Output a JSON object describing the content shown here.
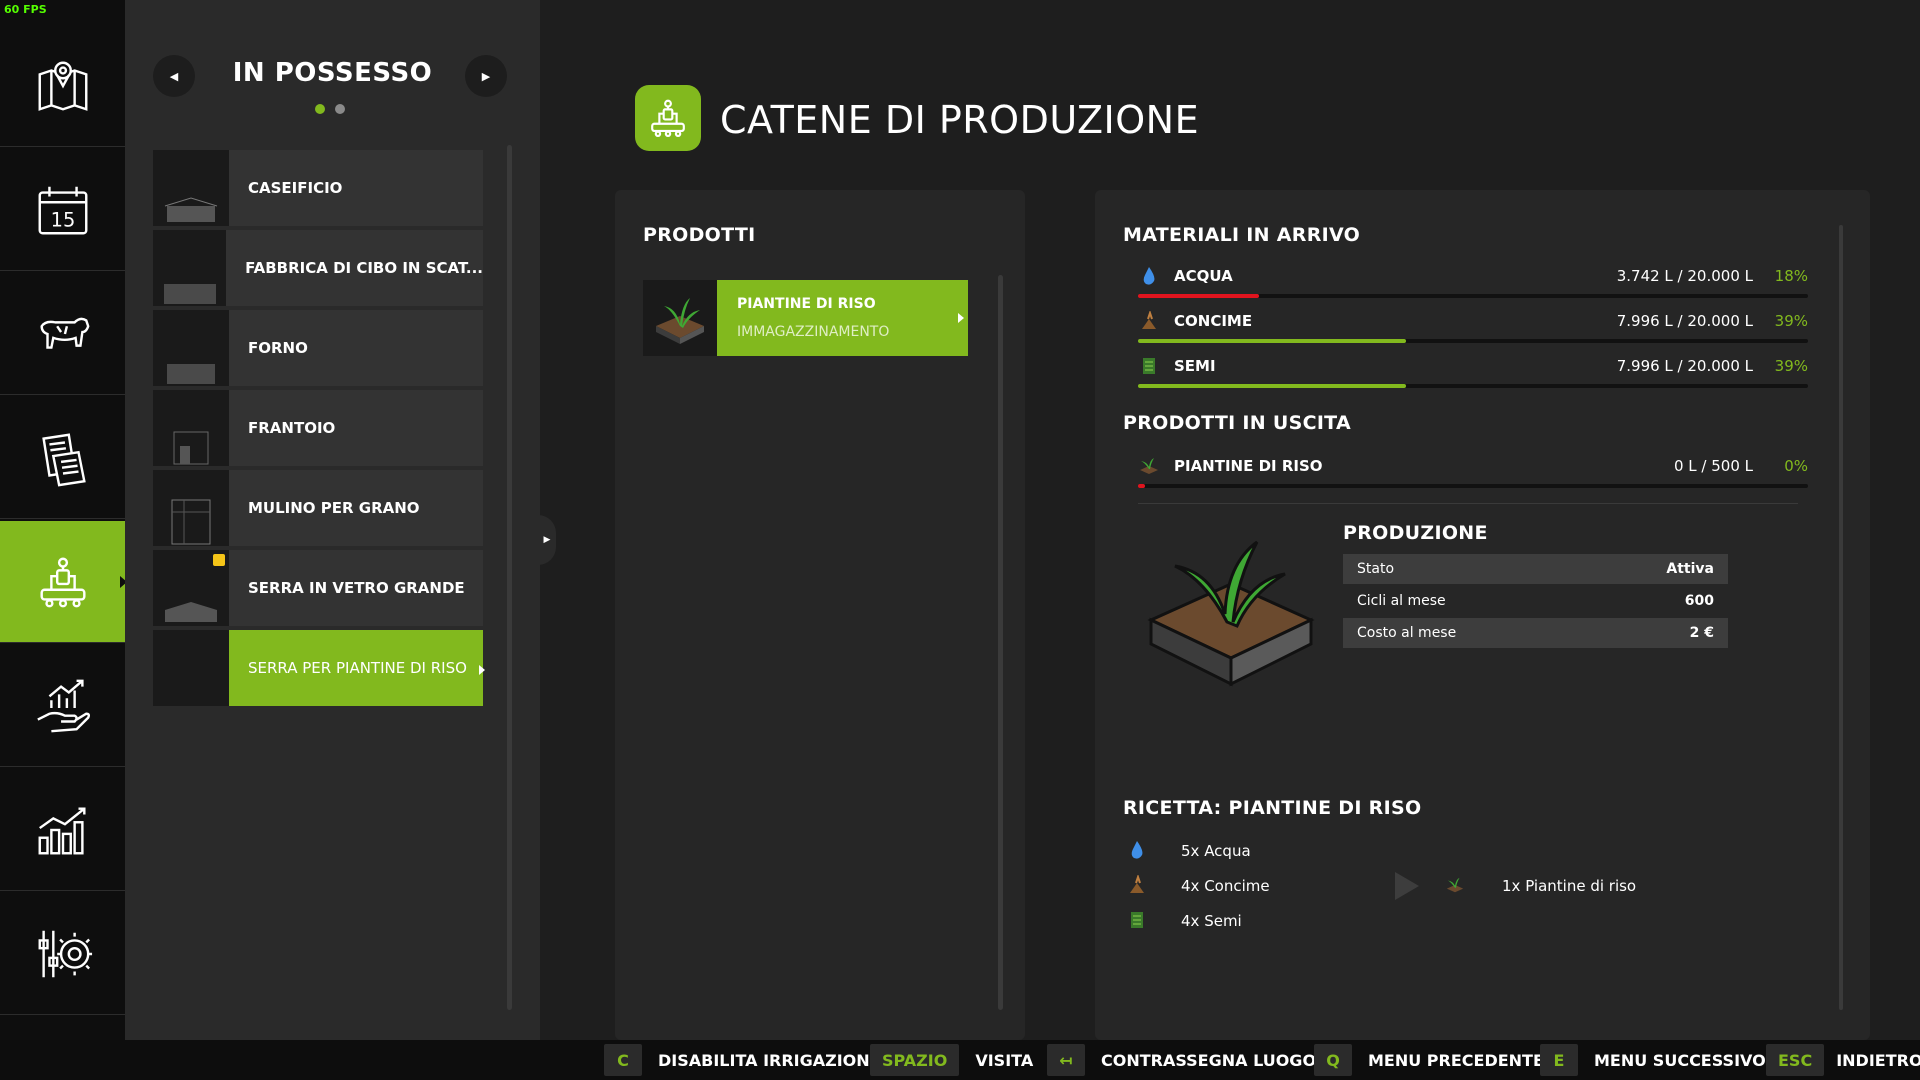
{
  "fps": "60 FPS",
  "colors": {
    "accent": "#82b91e",
    "red": "#e0141e",
    "water": "#3f8fe8"
  },
  "nav": {
    "items": [
      {
        "name": "map",
        "icon": "map-icon"
      },
      {
        "name": "calendar",
        "icon": "calendar-icon",
        "text": "15"
      },
      {
        "name": "animals",
        "icon": "cow-icon"
      },
      {
        "name": "contracts",
        "icon": "documents-icon"
      },
      {
        "name": "production",
        "icon": "production-icon",
        "active": true
      },
      {
        "name": "finances",
        "icon": "finance-hand-icon"
      },
      {
        "name": "statistics",
        "icon": "bar-chart-icon"
      },
      {
        "name": "settings",
        "icon": "settings-icon"
      }
    ]
  },
  "owned": {
    "title": "IN POSSESSO",
    "prev_icon": "chevron-left-icon",
    "next_icon": "chevron-right-icon",
    "page_count": 2,
    "current_page": 1,
    "items": [
      {
        "label": "CASEIFICIO"
      },
      {
        "label": "FABBRICA DI CIBO IN SCAT..."
      },
      {
        "label": "FORNO"
      },
      {
        "label": "FRANTOIO"
      },
      {
        "label": "MULINO PER GRANO"
      },
      {
        "label": "SERRA IN VETRO GRANDE",
        "badge": true
      },
      {
        "label": "SERRA PER PIANTINE DI RISO",
        "active": true
      }
    ]
  },
  "header": {
    "title": "CATENE DI PRODUZIONE",
    "icon": "production-icon"
  },
  "products": {
    "title": "PRODOTTI",
    "items": [
      {
        "name": "PIANTINE DI RISO",
        "sub": "IMMAGAZZINAMENTO",
        "icon": "rice-seedling-icon"
      }
    ]
  },
  "inputs": {
    "title": "MATERIALI IN ARRIVO",
    "items": [
      {
        "name": "ACQUA",
        "amount": "3.742 L / 20.000 L",
        "pct_label": "18%",
        "fill": 0.18,
        "color": "#e0141e",
        "icon": "water-drop-icon"
      },
      {
        "name": "CONCIME",
        "amount": "7.996 L / 20.000 L",
        "pct_label": "39%",
        "fill": 0.4,
        "color": "#82b91e",
        "icon": "fertilizer-icon"
      },
      {
        "name": "SEMI",
        "amount": "7.996 L / 20.000 L",
        "pct_label": "39%",
        "fill": 0.4,
        "color": "#82b91e",
        "icon": "seeds-bag-icon"
      }
    ]
  },
  "outputs": {
    "title": "PRODOTTI IN USCITA",
    "items": [
      {
        "name": "PIANTINE DI RISO",
        "amount": "0 L / 500 L",
        "pct_label": "0%",
        "fill": 0.01,
        "color": "#e0141e",
        "icon": "rice-seedling-icon"
      }
    ]
  },
  "production": {
    "title": "PRODUZIONE",
    "rows": [
      {
        "label": "Stato",
        "value": "Attiva"
      },
      {
        "label": "Cicli al mese",
        "value": "600"
      },
      {
        "label": "Costo al mese",
        "value": "2 €"
      }
    ]
  },
  "recipe": {
    "title": "RICETTA: PIANTINE DI RISO",
    "inputs": [
      {
        "label": "5x Acqua",
        "icon": "water-drop-icon"
      },
      {
        "label": "4x Concime",
        "icon": "fertilizer-icon"
      },
      {
        "label": "4x Semi",
        "icon": "seeds-bag-icon"
      }
    ],
    "output": {
      "label": "1x Piantine di riso",
      "icon": "rice-seedling-icon"
    }
  },
  "hotkeys": [
    {
      "key": "C",
      "label": "DISABILITA IRRIGAZIONE"
    },
    {
      "key": "SPAZIO",
      "label": "VISITA"
    },
    {
      "key": "↤",
      "label": "CONTRASSEGNA LUOGO"
    },
    {
      "key": "Q",
      "label": "MENU PRECEDENTE"
    },
    {
      "key": "E",
      "label": "MENU SUCCESSIVO"
    },
    {
      "key": "ESC",
      "label": "INDIETRO"
    }
  ]
}
